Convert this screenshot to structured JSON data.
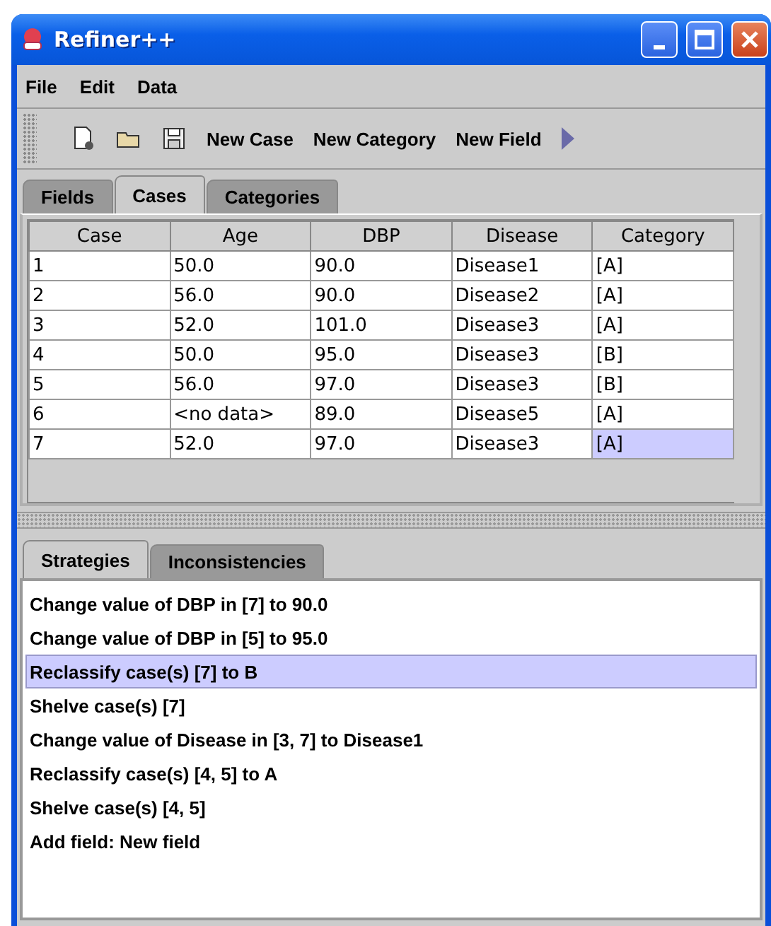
{
  "window": {
    "title": "Refiner++"
  },
  "menu": [
    "File",
    "Edit",
    "Data"
  ],
  "toolbar": {
    "buttons": [
      "New Case",
      "New Category",
      "New Field"
    ]
  },
  "top_tabs": [
    {
      "label": "Fields",
      "selected": false
    },
    {
      "label": "Cases",
      "selected": true
    },
    {
      "label": "Categories",
      "selected": false
    }
  ],
  "table": {
    "columns": [
      "Case",
      "Age",
      "DBP",
      "Disease",
      "Category"
    ],
    "rows": [
      {
        "cells": [
          "1",
          "50.0",
          "90.0",
          "Disease1",
          "[A]"
        ],
        "category_selected": false
      },
      {
        "cells": [
          "2",
          "56.0",
          "90.0",
          "Disease2",
          "[A]"
        ],
        "category_selected": false
      },
      {
        "cells": [
          "3",
          "52.0",
          "101.0",
          "Disease3",
          "[A]"
        ],
        "category_selected": false
      },
      {
        "cells": [
          "4",
          "50.0",
          "95.0",
          "Disease3",
          "[B]"
        ],
        "category_selected": false
      },
      {
        "cells": [
          "5",
          "56.0",
          "97.0",
          "Disease3",
          "[B]"
        ],
        "category_selected": false
      },
      {
        "cells": [
          "6",
          "<no data>",
          "89.0",
          "Disease5",
          "[A]"
        ],
        "category_selected": false
      },
      {
        "cells": [
          "7",
          "52.0",
          "97.0",
          "Disease3",
          "[A]"
        ],
        "category_selected": true
      }
    ]
  },
  "bottom_tabs": [
    {
      "label": "Strategies",
      "selected": true
    },
    {
      "label": "Inconsistencies",
      "selected": false
    }
  ],
  "strategies": [
    {
      "label": "Change value of DBP in [7] to 90.0",
      "selected": false
    },
    {
      "label": "Change value of DBP in [5] to 95.0",
      "selected": false
    },
    {
      "label": "Reclassify case(s) [7] to B",
      "selected": true
    },
    {
      "label": "Shelve case(s) [7]",
      "selected": false
    },
    {
      "label": "Change value of Disease in [3, 7] to Disease1",
      "selected": false
    },
    {
      "label": "Reclassify case(s) [4, 5] to A",
      "selected": false
    },
    {
      "label": "Shelve case(s) [4, 5]",
      "selected": false
    },
    {
      "label": "Add field: New field",
      "selected": false
    }
  ]
}
